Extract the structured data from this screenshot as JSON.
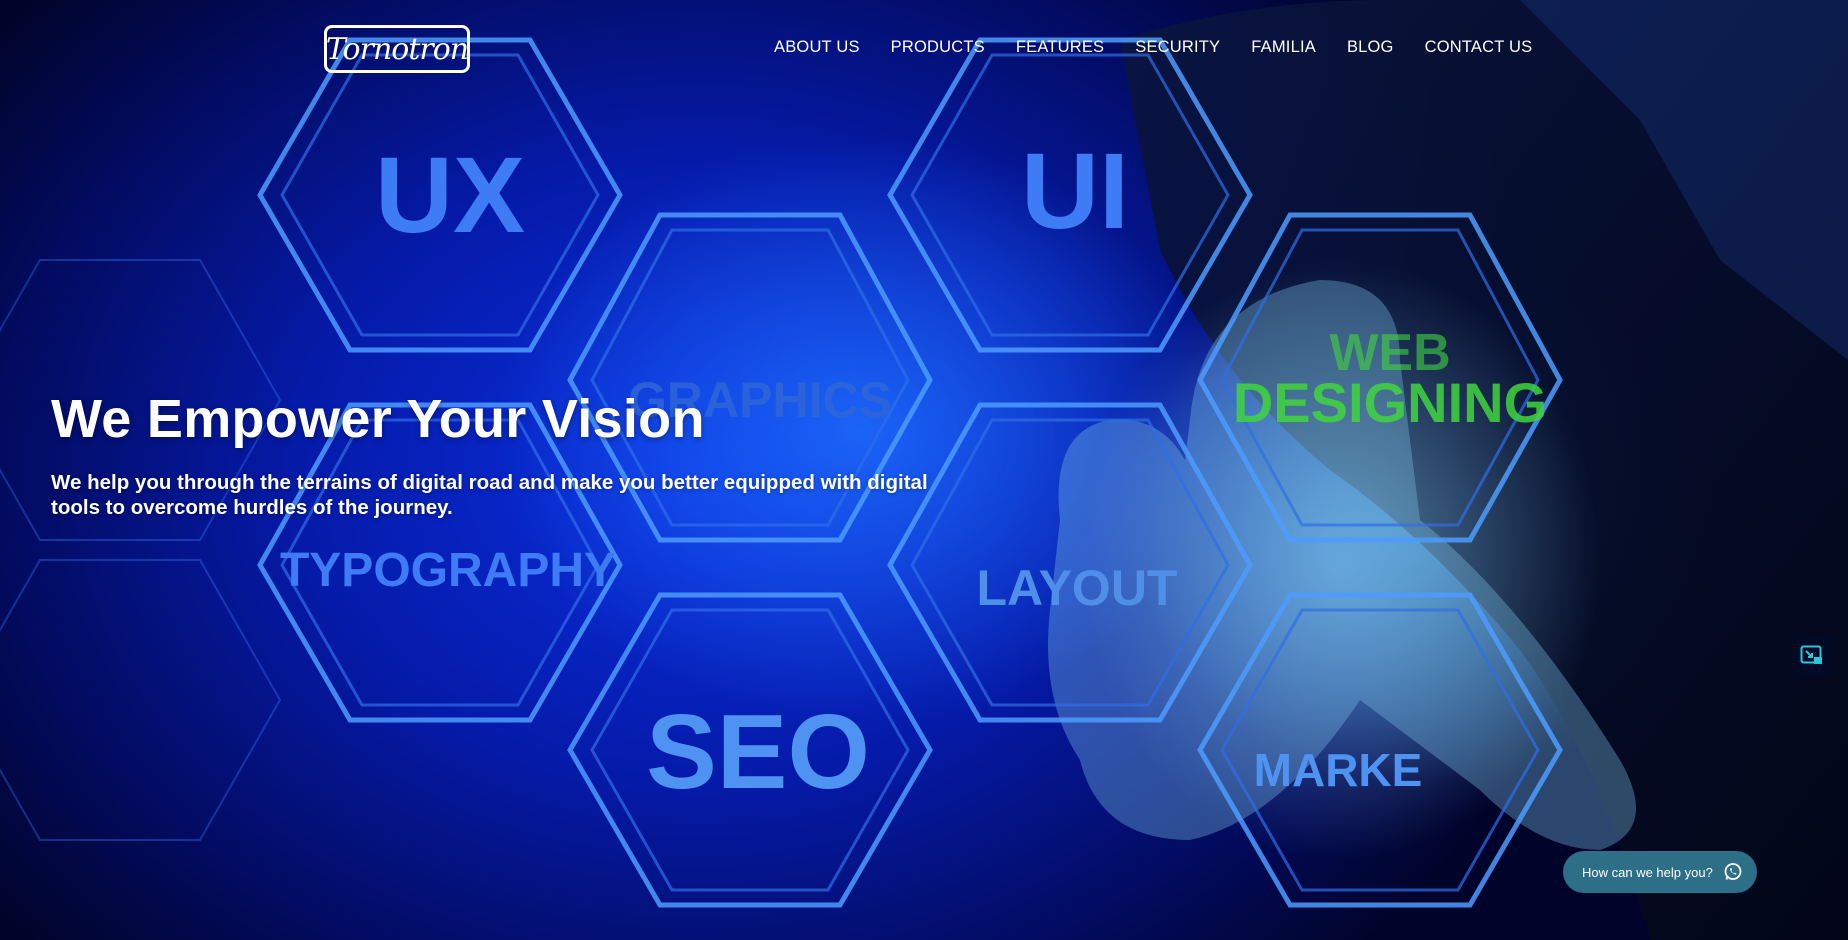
{
  "header": {
    "logo_text": "Tornotron",
    "nav": [
      {
        "label": "ABOUT US"
      },
      {
        "label": "PRODUCTS"
      },
      {
        "label": "FEATURES"
      },
      {
        "label": "SECURITY"
      },
      {
        "label": "FAMILIA"
      },
      {
        "label": "BLOG"
      },
      {
        "label": "CONTACT US"
      }
    ]
  },
  "hero": {
    "title": "We Empower Your Vision",
    "subtitle": "We help you through the terrains of digital road and make you better equipped with digital tools to overcome hurdles of the journey.",
    "background_words": {
      "ux": "UX",
      "ui": "UI",
      "graphics": "GRAPHICS",
      "web": "WEB",
      "designing": "DESIGNING",
      "typography": "TYPOGRAPHY",
      "layout": "LAYOUT",
      "seo": "SEO",
      "marke": "MARKE"
    }
  },
  "widgets": {
    "side_icon": "expand-icon",
    "chat_label": "How can we help you?",
    "chat_icon": "whatsapp-icon"
  },
  "colors": {
    "background": "#051aa8",
    "hex_outline": "#4d9cff",
    "web_designing": "#3fd63f",
    "chat_button": "#2c6f86",
    "side_icon_accent": "#28c8d8"
  }
}
